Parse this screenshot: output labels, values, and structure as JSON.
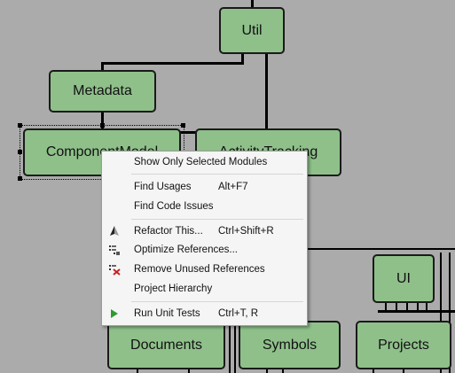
{
  "diagram": {
    "modules": {
      "util": "Util",
      "metadata": "Metadata",
      "component_model": "ComponentModel",
      "activity_tracking": "ActivityTracking",
      "ui": "UI",
      "documents": "Documents",
      "symbols": "Symbols",
      "projects": "Projects"
    }
  },
  "context_menu": {
    "items": [
      {
        "label": "Show Only Selected Modules",
        "shortcut": "",
        "icon": ""
      },
      {
        "label": "Find Usages",
        "shortcut": "Alt+F7",
        "icon": ""
      },
      {
        "label": "Find Code Issues",
        "shortcut": "",
        "icon": ""
      },
      {
        "label": "Refactor This...",
        "shortcut": "Ctrl+Shift+R",
        "icon": "refactor-icon"
      },
      {
        "label": "Optimize References...",
        "shortcut": "",
        "icon": "optimize-references-icon"
      },
      {
        "label": "Remove Unused References",
        "shortcut": "",
        "icon": "remove-references-icon"
      },
      {
        "label": "Project Hierarchy",
        "shortcut": "",
        "icon": ""
      },
      {
        "label": "Run Unit Tests",
        "shortcut": "Ctrl+T, R",
        "icon": "run-tests-icon"
      }
    ]
  },
  "colors": {
    "background": "#ababab",
    "node_fill": "#8fc08a",
    "node_border": "#1a1a1a",
    "menu_background": "#f5f5f5",
    "run_icon": "#2e9b2e"
  }
}
